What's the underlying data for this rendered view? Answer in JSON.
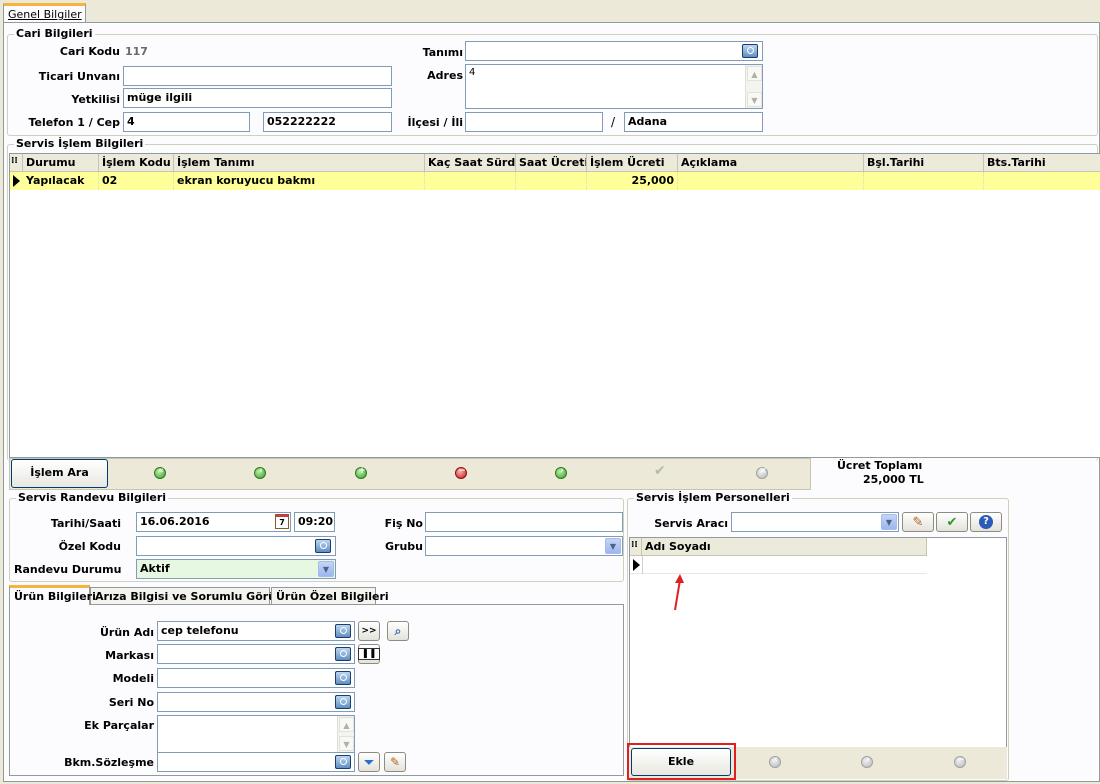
{
  "main_tab": "Genel Bilgiler",
  "cari": {
    "title": "Cari Bilgileri",
    "cari_kodu_label": "Cari Kodu",
    "cari_kodu_value": "117",
    "ticari_unvan_label": "Ticari Unvanı",
    "ticari_unvan_value": "",
    "yetkili_label": "Yetkilisi",
    "yetkili_value": "müge ilgili",
    "telefon_label": "Telefon 1 / Cep",
    "telefon1_value": "4",
    "cep_value": "052222222",
    "tanim_label": "Tanımı",
    "tanim_value": "",
    "adres_label": "Adres",
    "adres_value": "4",
    "ilce_label": "İlçesi / İli",
    "ilce_value": "",
    "separator": "/",
    "il_value": "Adana"
  },
  "servis_islem": {
    "title": "Servis İşlem Bilgileri",
    "columns": [
      "Durumu",
      "İşlem Kodu",
      "İşlem Tanımı",
      "Kaç Saat Sürdü",
      "Saat Ücreti",
      "İşlem Ücreti",
      "Açıklama",
      "Bşl.Tarihi",
      "Bts.Tarihi"
    ],
    "rows": [
      {
        "durumu": "Yapılacak",
        "islem_kodu": "02",
        "islem_tanimi": "ekran koruyucu bakmı",
        "kac_saat": "",
        "saat_ucreti": "",
        "islem_ucreti": "25,000",
        "aciklama": "",
        "bsl_tarihi": "",
        "bts_tarihi": ""
      }
    ],
    "islem_ara_label": "İşlem Ara",
    "ucret_toplam_label": "Ücret Toplamı",
    "ucret_toplam_value": "25,000 TL"
  },
  "randevu": {
    "title": "Servis Randevu Bilgileri",
    "tarih_label": "Tarihi/Saati",
    "tarih_value": "16.06.2016",
    "calendar_day": "7",
    "saat_value": "09:20",
    "ozel_kodu_label": "Özel Kodu",
    "ozel_kodu_value": "",
    "randevu_durumu_label": "Randevu Durumu",
    "randevu_durumu_value": "Aktif",
    "fis_no_label": "Fiş No",
    "fis_no_value": "",
    "grubu_label": "Grubu",
    "grubu_value": ""
  },
  "sub_tabs": [
    "Ürün Bilgileri",
    "Arıza Bilgisi ve Sorumlu Görüşü",
    "Ürün Özel Bilgileri"
  ],
  "urun": {
    "urun_adi_label": "Ürün Adı",
    "urun_adi_value": "cep telefonu",
    "next_button": ">>",
    "markasi_label": "Markası",
    "markasi_value": "",
    "modeli_label": "Modeli",
    "modeli_value": "",
    "seri_no_label": "Seri No",
    "seri_no_value": "",
    "ek_parcalar_label": "Ek Parçalar",
    "ek_parcalar_value": "",
    "bkm_label": "Bkm.Sözleşme",
    "bkm_value": ""
  },
  "personel": {
    "title": "Servis İşlem Personelleri",
    "servis_araci_label": "Servis Aracı",
    "servis_araci_value": "",
    "column": "Adı Soyadı",
    "ekle_label": "Ekle"
  },
  "colors": {
    "highlight_row": "#ffff99",
    "annotation_red": "#e02020",
    "tab_accent": "#f5b43f"
  }
}
